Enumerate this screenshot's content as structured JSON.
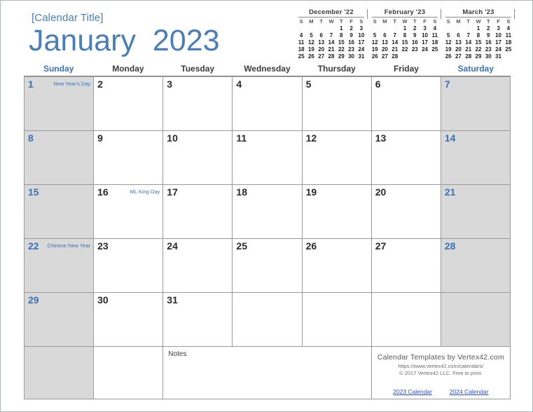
{
  "header": {
    "calendar_title": "[Calendar Title]",
    "month_year": "January  2023",
    "month": "January",
    "year": "2023",
    "title_color": "#4a7ebb"
  },
  "mini_calendars": [
    {
      "title": "December '22",
      "weekday_initials": [
        "S",
        "M",
        "T",
        "W",
        "T",
        "F",
        "S"
      ],
      "weeks": [
        [
          "",
          "",
          "",
          "",
          "1",
          "2",
          "3"
        ],
        [
          "4",
          "5",
          "6",
          "7",
          "8",
          "9",
          "10"
        ],
        [
          "11",
          "12",
          "13",
          "14",
          "15",
          "16",
          "17"
        ],
        [
          "18",
          "19",
          "20",
          "21",
          "22",
          "23",
          "24"
        ],
        [
          "25",
          "26",
          "27",
          "28",
          "29",
          "30",
          "31"
        ]
      ]
    },
    {
      "title": "February '23",
      "weekday_initials": [
        "S",
        "M",
        "T",
        "W",
        "T",
        "F",
        "S"
      ],
      "weeks": [
        [
          "",
          "",
          "",
          "1",
          "2",
          "3",
          "4"
        ],
        [
          "5",
          "6",
          "7",
          "8",
          "9",
          "10",
          "11"
        ],
        [
          "12",
          "13",
          "14",
          "15",
          "16",
          "17",
          "18"
        ],
        [
          "19",
          "20",
          "21",
          "22",
          "23",
          "24",
          "25"
        ],
        [
          "26",
          "27",
          "28",
          "",
          "",
          "",
          ""
        ]
      ]
    },
    {
      "title": "March '23",
      "weekday_initials": [
        "S",
        "M",
        "T",
        "W",
        "T",
        "F",
        "S"
      ],
      "weeks": [
        [
          "",
          "",
          "",
          "1",
          "2",
          "3",
          "4"
        ],
        [
          "5",
          "6",
          "7",
          "8",
          "9",
          "10",
          "11"
        ],
        [
          "12",
          "13",
          "14",
          "15",
          "16",
          "17",
          "18"
        ],
        [
          "19",
          "20",
          "21",
          "22",
          "23",
          "24",
          "25"
        ],
        [
          "26",
          "27",
          "28",
          "29",
          "30",
          "31",
          ""
        ]
      ]
    }
  ],
  "weekday_headers": [
    {
      "label": "Sunday",
      "weekend": true
    },
    {
      "label": "Monday",
      "weekend": false
    },
    {
      "label": "Tuesday",
      "weekend": false
    },
    {
      "label": "Wednesday",
      "weekend": false
    },
    {
      "label": "Thursday",
      "weekend": false
    },
    {
      "label": "Friday",
      "weekend": false
    },
    {
      "label": "Saturday",
      "weekend": true
    }
  ],
  "weeks": [
    [
      {
        "day": "1",
        "event": "New Year's Day",
        "weekend": true
      },
      {
        "day": "2",
        "event": "",
        "weekend": false
      },
      {
        "day": "3",
        "event": "",
        "weekend": false
      },
      {
        "day": "4",
        "event": "",
        "weekend": false
      },
      {
        "day": "5",
        "event": "",
        "weekend": false
      },
      {
        "day": "6",
        "event": "",
        "weekend": false
      },
      {
        "day": "7",
        "event": "",
        "weekend": true
      }
    ],
    [
      {
        "day": "8",
        "event": "",
        "weekend": true
      },
      {
        "day": "9",
        "event": "",
        "weekend": false
      },
      {
        "day": "10",
        "event": "",
        "weekend": false
      },
      {
        "day": "11",
        "event": "",
        "weekend": false
      },
      {
        "day": "12",
        "event": "",
        "weekend": false
      },
      {
        "day": "13",
        "event": "",
        "weekend": false
      },
      {
        "day": "14",
        "event": "",
        "weekend": true
      }
    ],
    [
      {
        "day": "15",
        "event": "",
        "weekend": true
      },
      {
        "day": "16",
        "event": "ML King Day",
        "weekend": false
      },
      {
        "day": "17",
        "event": "",
        "weekend": false
      },
      {
        "day": "18",
        "event": "",
        "weekend": false
      },
      {
        "day": "19",
        "event": "",
        "weekend": false
      },
      {
        "day": "20",
        "event": "",
        "weekend": false
      },
      {
        "day": "21",
        "event": "",
        "weekend": true
      }
    ],
    [
      {
        "day": "22",
        "event": "Chinese New Year",
        "weekend": true
      },
      {
        "day": "23",
        "event": "",
        "weekend": false
      },
      {
        "day": "24",
        "event": "",
        "weekend": false
      },
      {
        "day": "25",
        "event": "",
        "weekend": false
      },
      {
        "day": "26",
        "event": "",
        "weekend": false
      },
      {
        "day": "27",
        "event": "",
        "weekend": false
      },
      {
        "day": "28",
        "event": "",
        "weekend": true
      }
    ],
    [
      {
        "day": "29",
        "event": "",
        "weekend": true
      },
      {
        "day": "30",
        "event": "",
        "weekend": false
      },
      {
        "day": "31",
        "event": "",
        "weekend": false
      },
      {
        "day": "",
        "event": "",
        "weekend": false
      },
      {
        "day": "",
        "event": "",
        "weekend": false
      },
      {
        "day": "",
        "event": "",
        "weekend": false
      },
      {
        "day": "",
        "event": "",
        "weekend": true
      }
    ]
  ],
  "notes_row": {
    "notes_label": "Notes"
  },
  "footer": {
    "line1": "Calendar Templates by Vertex42.com",
    "line2": "https://www.vertex42.com/calendars/",
    "line3": "© 2017 Vertex42 LLC. Free to print.",
    "link_prev": "2023 Calendar",
    "link_next": "2024 Calendar",
    "link_color": "#2b4ddb"
  },
  "colors": {
    "accent_blue": "#4a7ebb",
    "weekend_gray": "#d9d9d9",
    "grid_border": "#9a9a9a",
    "text_dark": "#2a2a2a"
  }
}
